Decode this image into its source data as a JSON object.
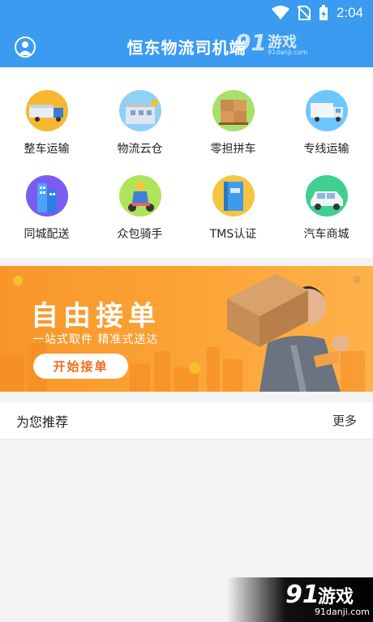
{
  "status_bar": {
    "time": "2:04"
  },
  "app_bar": {
    "title": "恒东物流司机端"
  },
  "grid": [
    {
      "label": "整车运输",
      "icon": "truck-icon",
      "color": "#f7b731"
    },
    {
      "label": "物流云仓",
      "icon": "warehouse-icon",
      "color": "#8fd0f7"
    },
    {
      "label": "零担拼车",
      "icon": "boxes-icon",
      "color": "#a8e06b"
    },
    {
      "label": "专线运输",
      "icon": "van-icon",
      "color": "#6ec6ff"
    },
    {
      "label": "同城配送",
      "icon": "city-building-icon",
      "color": "#7b5cf2"
    },
    {
      "label": "众包骑手",
      "icon": "rider-icon",
      "color": "#aee35a"
    },
    {
      "label": "TMS认证",
      "icon": "book-icon",
      "color": "#f5c542"
    },
    {
      "label": "汽车商城",
      "icon": "car-icon",
      "color": "#3fcf8e"
    }
  ],
  "banner": {
    "headline": "自由接单",
    "subline": "一站式取件 精准式送达",
    "cta": "开始接单"
  },
  "recommend": {
    "title": "为您推荐",
    "more": "更多"
  },
  "watermark": {
    "top_big": "91",
    "top_cn": "游戏",
    "top_sub": "91danji.com",
    "bottom_big": "91",
    "bottom_cn": "游戏",
    "bottom_sub": "91danji.com"
  },
  "colors": {
    "primary": "#3a9bf0",
    "banner_orange": "#f8962a",
    "cta_text": "#f26b1d"
  }
}
